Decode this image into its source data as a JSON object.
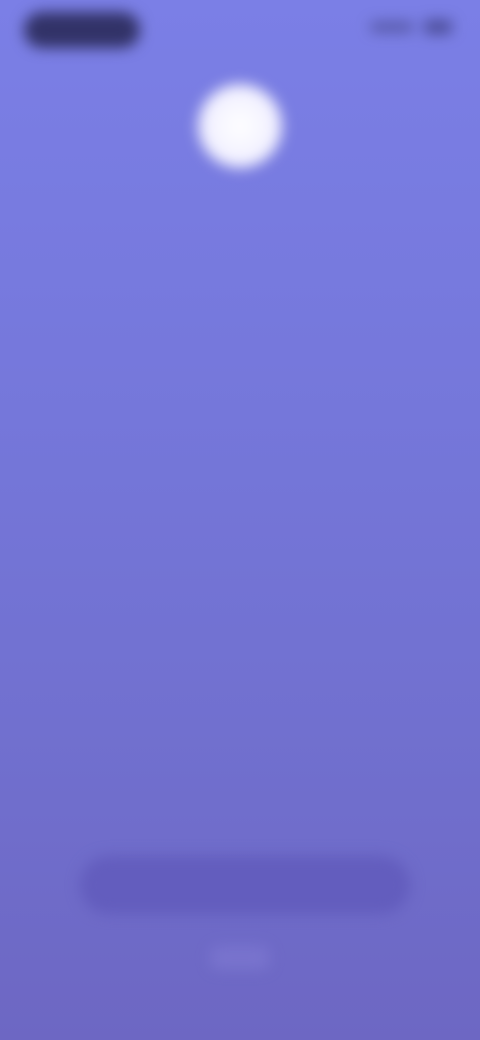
{
  "theme": {
    "background_top": "#7b7fe6",
    "background_bottom": "#6d67c3",
    "accent": "#5f58b9"
  },
  "status_bar": {
    "left_icon": "status-pill-icon",
    "right_icons": [
      "signal-icon",
      "battery-icon"
    ]
  },
  "header": {
    "logo_icon": "app-logo-icon",
    "tagline": ""
  },
  "main": {
    "center_link": ""
  },
  "footer": {
    "cta_label": "",
    "secondary_label": ""
  }
}
